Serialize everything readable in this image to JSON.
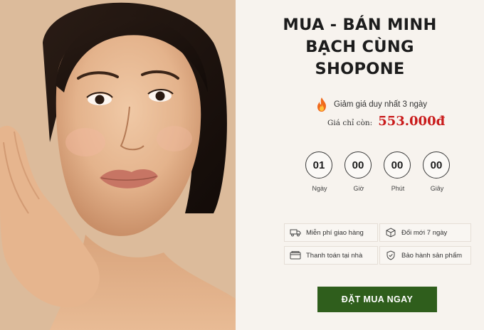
{
  "hero": {
    "image": "woman-portrait-photo"
  },
  "headline": {
    "line1": "MUA - BÁN MINH",
    "line2": "BẠCH CÙNG",
    "line3": "SHOPONE"
  },
  "promo": {
    "icon": "fire-icon",
    "text": "Giảm giá duy nhất 3 ngày"
  },
  "price": {
    "label": "Giá chỉ còn:",
    "value": "553.000đ",
    "color": "#c91b1b"
  },
  "countdown": [
    {
      "value": "01",
      "label": "Ngày"
    },
    {
      "value": "00",
      "label": "Giờ"
    },
    {
      "value": "00",
      "label": "Phút"
    },
    {
      "value": "00",
      "label": "Giây"
    }
  ],
  "features": [
    {
      "icon": "truck-icon",
      "text": "Miễn phí giao hàng"
    },
    {
      "icon": "box-icon",
      "text": "Đổi mới 7 ngày"
    },
    {
      "icon": "wallet-icon",
      "text": "Thanh toán tại nhà"
    },
    {
      "icon": "shield-icon",
      "text": "Bảo hành sản phẩm"
    }
  ],
  "cta": {
    "label": "ĐẶT MUA NGAY",
    "color": "#2f5e1c"
  }
}
